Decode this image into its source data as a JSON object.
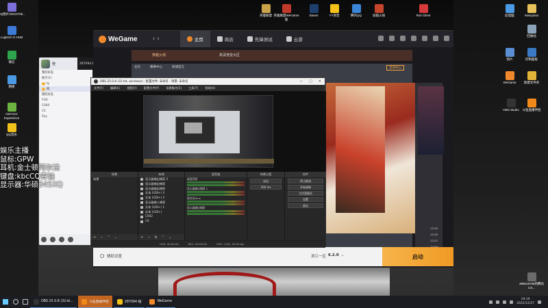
{
  "overlay": {
    "lines": [
      "娱乐主播",
      "鼠标:GPW",
      "耳机:金士顿阿尔法",
      "键盘:kbcCQ青轴",
      "显示器:华硕345XQ"
    ]
  },
  "desktop_left": [
    {
      "label": "QQ图片20210705...",
      "color": "#7d6fd9"
    },
    {
      "label": "Logitech G HUB",
      "color": "#3e7bd8"
    },
    {
      "label": "微信",
      "color": "#2ea44f"
    },
    {
      "label": "网络",
      "color": "#4b9ae6"
    },
    {
      "label": "GeForce Experience",
      "color": "#6cb33f"
    },
    {
      "label": "QQ音乐",
      "color": "#f2c21b"
    }
  ],
  "desktop_top": [
    {
      "label": "英雄联盟",
      "color": "#c9a24a"
    },
    {
      "label": "英雄联盟WeGame版",
      "color": "#c0392b"
    },
    {
      "label": "Steam",
      "color": "#1d3f6e"
    },
    {
      "label": "YY语音",
      "color": "#f6c219"
    },
    {
      "label": "腾讯QQ",
      "color": "#3a85d6"
    },
    {
      "label": "穿越火线",
      "color": "#c4452b"
    },
    {
      "label": "Riot Client",
      "color": "#d43a3a"
    }
  ],
  "desktop_right": [
    {
      "label": "此电脑",
      "color": "#4b9ae6"
    },
    {
      "label": "mieuyoiao",
      "color": "#e8c15a"
    },
    {
      "label": "回收站",
      "color": "#8aa3b8"
    },
    {
      "label": "照片",
      "color": "#5a8fd6"
    },
    {
      "label": "控制面板",
      "color": "#3b79c4"
    },
    {
      "label": "WeGame",
      "color": "#f0892b"
    },
    {
      "label": "新建文件夹",
      "color": "#e2b53a"
    },
    {
      "label": "OBS Studio",
      "color": "#333333"
    },
    {
      "label": "斗鱼直播伴侣",
      "color": "#f28a1b"
    },
    {
      "label": "399019706的腾讯CS...",
      "color": "#6b6b6b"
    }
  ],
  "qq": {
    "header": "橙",
    "rows": [
      "我的好友",
      "橙子(1)",
      "ty",
      "橙",
      "我的好友",
      "FO0",
      "C000",
      "C2",
      "Sey"
    ]
  },
  "small_window": {
    "title": "287094 橙"
  },
  "wegame": {
    "logo": "WeGame",
    "back": "‹ ›",
    "tabs": [
      "主页",
      "商店",
      "先锋测试",
      "云游"
    ],
    "strip_left": "穿越火线",
    "strip_right": "高清竞技大区",
    "panel_tabs": [
      "主页",
      "赛事中心",
      "商城官方"
    ],
    "panel_badge": "活动中心",
    "side_rows": [
      "12/18",
      "12/16",
      "12/13",
      "12/09",
      "12/05"
    ],
    "footer_settings": "辅助设置",
    "footer_region_label": "浙江一区",
    "footer_version": "6.2.0",
    "launch": "启动"
  },
  "obs": {
    "title": "OBS 25.0.8 (32-bit, windows) - 配置文件: 未命名 - 场景: 未命名",
    "menu": [
      "文件(F)",
      "编辑(E)",
      "视图(V)",
      "配置文件(P)",
      "场景集合(S)",
      "工具(T)",
      "帮助(H)"
    ],
    "docks": {
      "scenes": "场景",
      "sources": "来源",
      "mixer": "混音器",
      "transitions": "场景过渡",
      "controls": "控件"
    },
    "scene_items": [
      "场景"
    ],
    "source_items": [
      "显示器输出捕获 2",
      "显示器输出捕获",
      "显示器输出捕获",
      "文本 (GDI+) 3",
      "文本 (GDI+) 2",
      "显示器输入捕获",
      "文本 (GDI+) 1",
      "文本 (GDI+)",
      "C002",
      "C0"
    ],
    "mixer_items": [
      "桌面音频",
      "显示器输出捕获 2",
      "麦克风/Aux",
      "显示器输出捕获"
    ],
    "transition_value": "淡出",
    "transition_duration": "300 ms",
    "control_buttons": [
      "停止推流",
      "开始录制",
      "工作室模式",
      "设置",
      "退出"
    ],
    "status": [
      "LIVE: 00:00:00",
      "REC: 00:00:00",
      "CPU: 1.9%, 30.00 fps"
    ]
  },
  "taskbar": {
    "apps": [
      {
        "label": "OBS 25.0.8 (32-bi...",
        "color": "#333333",
        "active": false
      },
      {
        "label": "斗鱼直播伴侣",
        "color": "#f28a1b",
        "active": true
      },
      {
        "label": "287094 橙",
        "color": "#f2c21b",
        "active": false
      },
      {
        "label": "WeGame",
        "color": "#f0892b",
        "active": false
      }
    ],
    "time": "19:19",
    "date": "2022/12/27"
  }
}
